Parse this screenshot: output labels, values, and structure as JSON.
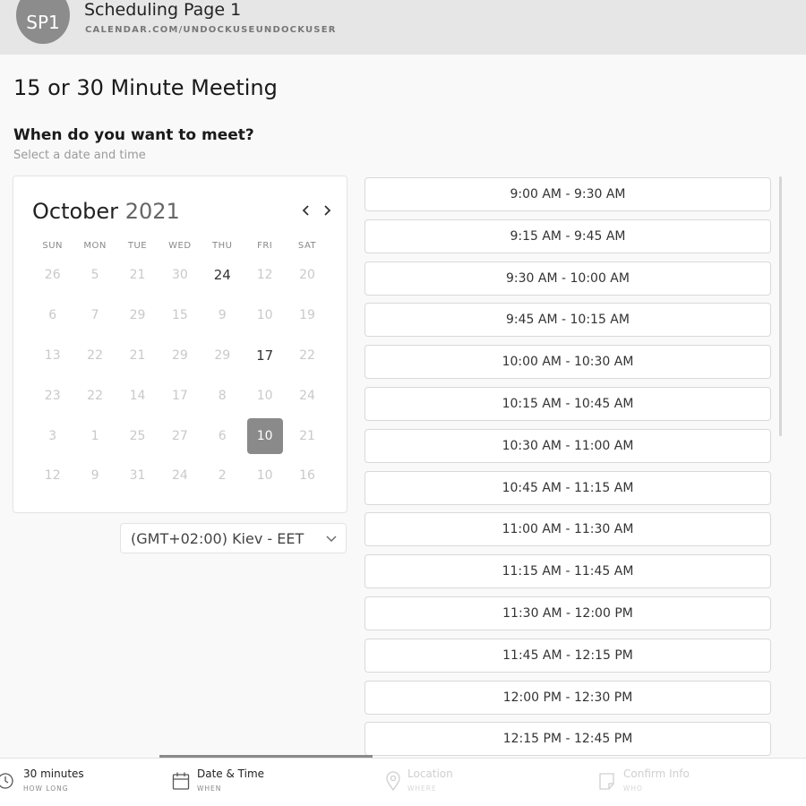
{
  "header": {
    "avatar": "SP1",
    "page_name": "Scheduling Page 1",
    "url": "CALENDAR.COM/UNDOCKUSEUNDOCKUSER"
  },
  "event_title": "15 or 30 Minute Meeting",
  "when": {
    "title": "When do you want to meet?",
    "subtitle": "Select a date and time"
  },
  "calendar": {
    "month": "October",
    "year": "2021",
    "weekdays": [
      "SUN",
      "MON",
      "TUE",
      "WED",
      "THU",
      "FRI",
      "SAT"
    ],
    "weeks": [
      [
        "26",
        "5",
        "21",
        "30",
        "24",
        "12",
        "20"
      ],
      [
        "6",
        "7",
        "29",
        "15",
        "9",
        "10",
        "19"
      ],
      [
        "13",
        "22",
        "21",
        "29",
        "29",
        "17",
        "22"
      ],
      [
        "23",
        "22",
        "14",
        "17",
        "8",
        "10",
        "24"
      ],
      [
        "3",
        "1",
        "25",
        "27",
        "6",
        "10",
        "21"
      ],
      [
        "12",
        "9",
        "31",
        "24",
        "2",
        "10",
        "16"
      ]
    ],
    "available": [
      [
        0,
        4
      ],
      [
        2,
        5
      ]
    ],
    "selected": [
      4,
      5
    ]
  },
  "timezone": "(GMT+02:00) Kiev - EET",
  "slots": [
    "9:00 AM - 9:30 AM",
    "9:15 AM - 9:45 AM",
    "9:30 AM - 10:00 AM",
    "9:45 AM - 10:15 AM",
    "10:00 AM - 10:30 AM",
    "10:15 AM - 10:45 AM",
    "10:30 AM - 11:00 AM",
    "10:45 AM - 11:15 AM",
    "11:00 AM - 11:30 AM",
    "11:15 AM - 11:45 AM",
    "11:30 AM - 12:00 PM",
    "11:45 AM - 12:15 PM",
    "12:00 PM - 12:30 PM",
    "12:15 PM - 12:45 PM"
  ],
  "steps": [
    {
      "label": "30 minutes",
      "sub": "HOW LONG",
      "icon": "clock-icon",
      "state": "done"
    },
    {
      "label": "Date & Time",
      "sub": "WHEN",
      "icon": "calendar-icon",
      "state": "done"
    },
    {
      "label": "Location",
      "sub": "WHERE",
      "icon": "location-pin-icon",
      "state": "pending"
    },
    {
      "label": "Confirm Info",
      "sub": "WHO",
      "icon": "note-icon",
      "state": "pending"
    }
  ],
  "colors": {
    "header_bg": "#e6e6e6",
    "selected_day": "#8a8a8a",
    "page_bg": "#f9f9f9"
  }
}
